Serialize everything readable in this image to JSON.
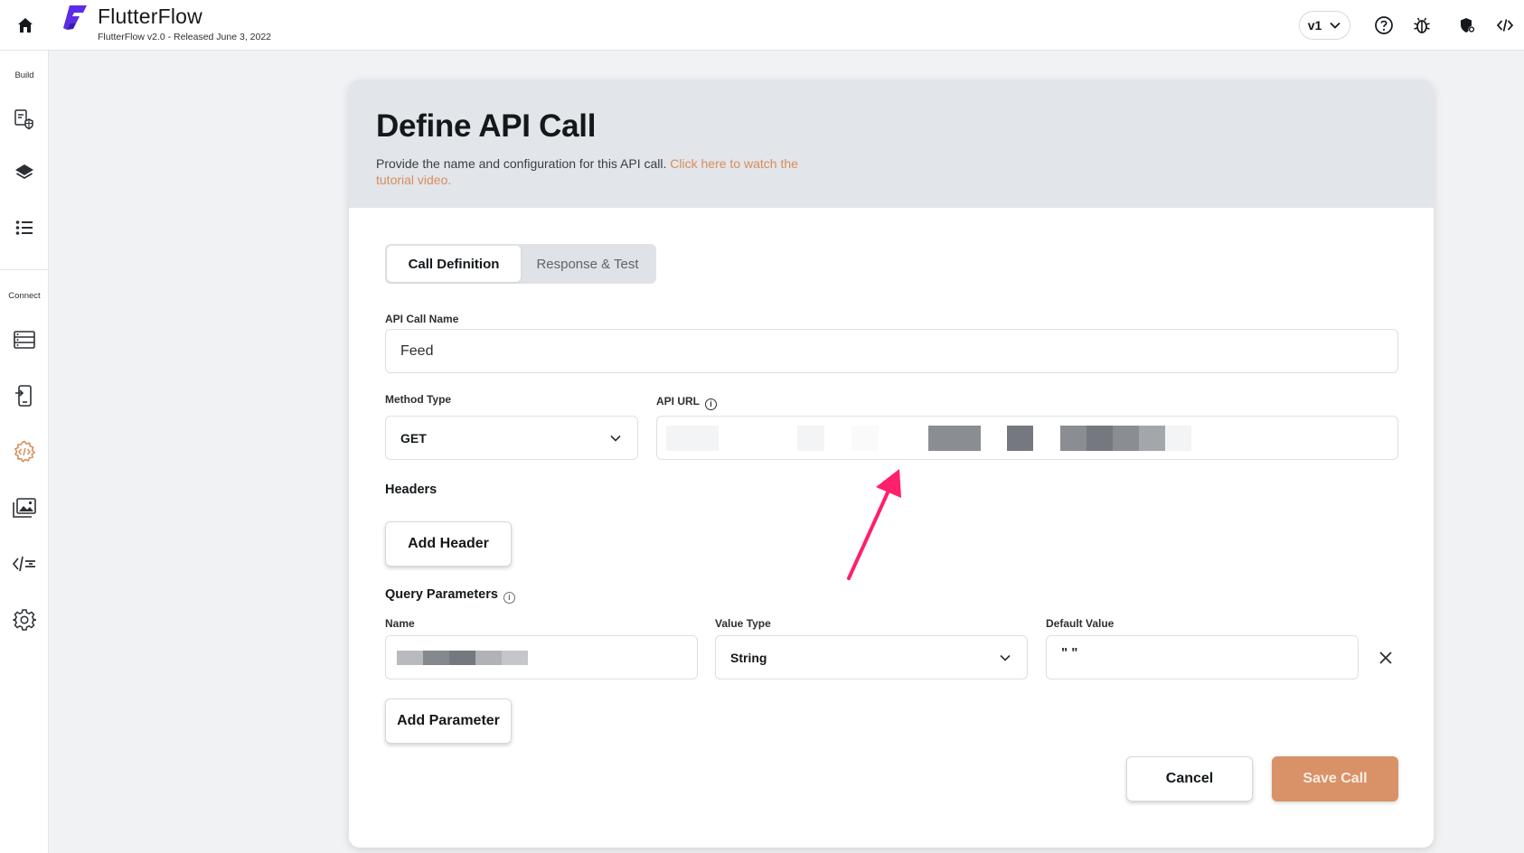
{
  "app": {
    "name": "FlutterFlow",
    "version_line": "FlutterFlow v2.0 - Released June 3, 2022",
    "brand_color": "#5B2DE6"
  },
  "topbar": {
    "version_selected": "v1",
    "icons": [
      "home-icon",
      "chevron-down-icon",
      "help-icon",
      "bug-icon",
      "shield-gear-icon",
      "code-icon"
    ]
  },
  "sidebar": {
    "build_label": "Build",
    "connect_label": "Connect",
    "build_items": [
      "theme-icon",
      "layers-icon",
      "storyboard-list-icon"
    ],
    "connect_items": [
      "firestore-icon",
      "app-state-icon",
      "api-calls-icon",
      "media-assets-icon",
      "custom-code-icon",
      "settings-icon"
    ],
    "active_color": "#D98D5C"
  },
  "dialog": {
    "title": "Define API Call",
    "description": "Provide the name and configuration for this API call.",
    "tutorial_link": "Click here to watch the tutorial video.",
    "tabs": [
      {
        "label": "Call Definition",
        "active": true
      },
      {
        "label": "Response & Test",
        "active": false
      }
    ],
    "api_call_name": {
      "label": "API Call Name",
      "value": "Feed"
    },
    "method_type": {
      "label": "Method Type",
      "value": "GET"
    },
    "api_url": {
      "label": "API URL",
      "value": ""
    },
    "headers": {
      "label": "Headers",
      "add_button": "Add Header"
    },
    "query_parameters": {
      "label": "Query Parameters",
      "columns": [
        "Name",
        "Value Type",
        "Default Value"
      ],
      "rows": [
        {
          "name": "",
          "value_type": "String",
          "default_value": "\" \""
        }
      ],
      "add_button": "Add Parameter"
    },
    "cancel_button": "Cancel",
    "save_button": "Save Call",
    "accent_color": "#D99268"
  }
}
